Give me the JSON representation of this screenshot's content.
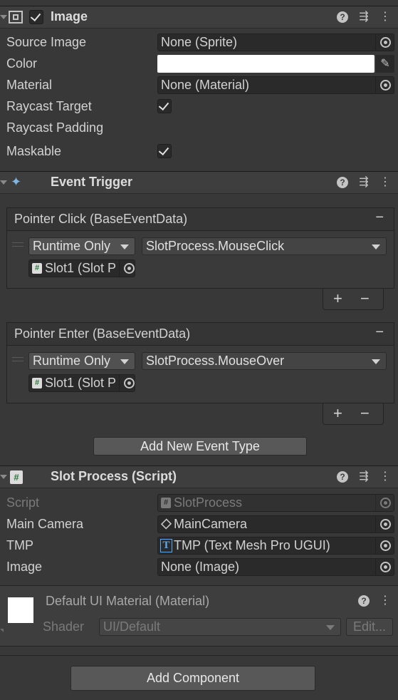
{
  "image_component": {
    "title": "Image",
    "fields": {
      "source_image": {
        "label": "Source Image",
        "value": "None (Sprite)"
      },
      "color": {
        "label": "Color",
        "value": "#FFFFFF"
      },
      "material": {
        "label": "Material",
        "value": "None (Material)"
      },
      "raycast_target": {
        "label": "Raycast Target",
        "checked": true
      },
      "raycast_padding": {
        "label": "Raycast Padding"
      },
      "maskable": {
        "label": "Maskable",
        "checked": true
      }
    }
  },
  "event_trigger": {
    "title": "Event Trigger",
    "events": [
      {
        "title": "Pointer Click (BaseEventData)",
        "mode": "Runtime Only",
        "function": "SlotProcess.MouseClick",
        "target": "Slot1 (Slot P"
      },
      {
        "title": "Pointer Enter (BaseEventData)",
        "mode": "Runtime Only",
        "function": "SlotProcess.MouseOver",
        "target": "Slot1 (Slot P"
      }
    ],
    "add_button": "Add New Event Type",
    "plus": "+",
    "minus": "−",
    "remove": "−"
  },
  "slot_process": {
    "title": "Slot Process (Script)",
    "fields": {
      "script": {
        "label": "Script",
        "value": "SlotProcess"
      },
      "main_camera": {
        "label": "Main Camera",
        "value": "MainCamera"
      },
      "tmp": {
        "label": "TMP",
        "value": "TMP (Text Mesh Pro UGUI)"
      },
      "image": {
        "label": "Image",
        "value": "None (Image)"
      }
    }
  },
  "material": {
    "title": "Default UI Material (Material)",
    "shader_label": "Shader",
    "shader_value": "UI/Default",
    "edit_button": "Edit..."
  },
  "add_component": "Add Component",
  "icons": {
    "help": "?",
    "tmp_icon": "T",
    "hash": "#"
  }
}
